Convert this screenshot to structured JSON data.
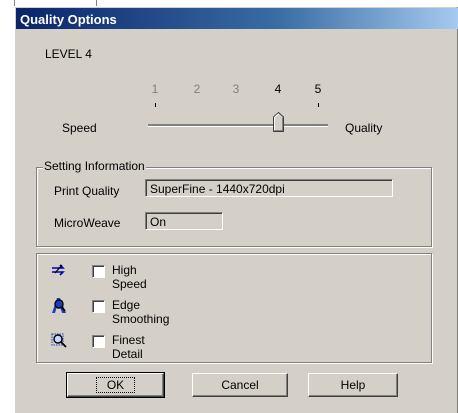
{
  "window": {
    "title": "Quality Options"
  },
  "level": {
    "label": "LEVEL 4"
  },
  "slider": {
    "ticks": [
      "1",
      "2",
      "3",
      "4",
      "5"
    ],
    "left_label": "Speed",
    "right_label": "Quality",
    "value": 4,
    "min": 1,
    "max": 5
  },
  "setting_info": {
    "title": "Setting Information",
    "print_quality_label": "Print Quality",
    "print_quality_value": "SuperFine - 1440x720dpi",
    "microweave_label": "MicroWeave",
    "microweave_value": "On"
  },
  "options": [
    {
      "label": "High Speed",
      "checked": false,
      "icon": "high-speed-icon"
    },
    {
      "label": "Edge Smoothing",
      "checked": false,
      "icon": "edge-smoothing-icon"
    },
    {
      "label": "Finest Detail",
      "checked": false,
      "icon": "finest-detail-icon"
    }
  ],
  "buttons": {
    "ok": "OK",
    "cancel": "Cancel",
    "help": "Help"
  },
  "colors": {
    "title_start": "#0a246a",
    "title_end": "#a6caf0",
    "face": "#d4d0c8"
  }
}
